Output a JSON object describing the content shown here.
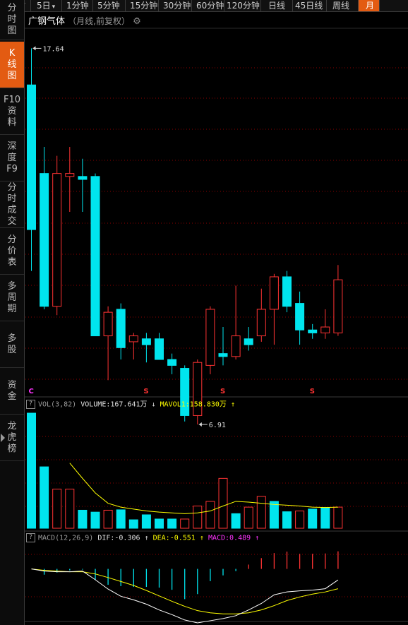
{
  "tabs": [
    "分时",
    "5日",
    "1分钟",
    "5分钟",
    "15分钟",
    "30分钟",
    "60分钟",
    "120分钟",
    "日线",
    "45日线",
    "周线",
    "月"
  ],
  "tabs_dropdown": "▾",
  "active_tab": 11,
  "sidebar": [
    "分\n时\n图",
    "K\n线\n图",
    "F10\n资\n料",
    "深\n度\nF9",
    "分\n时\n成\n交",
    "分\n价\n表",
    "多\n周\n期",
    "多\n股",
    "资\n金",
    "龙\n虎\n榜"
  ],
  "active_side": 1,
  "title": {
    "name": "广钢气体",
    "sub": "（月线,前复权）",
    "gear": "⚙"
  },
  "annotations": {
    "high_label": "17.64",
    "low_label": "6.91",
    "markers": [
      "C",
      "S",
      "S",
      "S"
    ]
  },
  "volume_header": {
    "q": "?",
    "vol_name": "VOL(3,82)",
    "volume": "VOLUME:167.641万",
    "volume_arrow": "↓",
    "mavol": "MAVOL1:158.830万",
    "mavol_arrow": "↑"
  },
  "macd_header": {
    "q": "?",
    "name": "MACD(12,26,9)",
    "dif": "DIF:-0.306",
    "dif_arrow": "↑",
    "dea": "DEA:-0.551",
    "dea_arrow": "↑",
    "macd": "MACD:0.489",
    "macd_arrow": "↑"
  },
  "colors": {
    "up": "#ff3333",
    "down": "#00e5ee",
    "ma": "#ffff00",
    "dif": "#ffffff",
    "dea": "#ffff00",
    "grid": "#8b0000",
    "accent": "#e35b12"
  },
  "chart_data": [
    {
      "type": "candlestick",
      "title": "广钢气体",
      "ylim": [
        6.0,
        18.2
      ],
      "high": 17.64,
      "low": 6.91,
      "candles": [
        {
          "o": 16.4,
          "c": 11.5,
          "h": 17.64,
          "l": 10.1
        },
        {
          "o": 13.4,
          "c": 8.9,
          "h": 14.3,
          "l": 8.8
        },
        {
          "o": 8.9,
          "c": 13.4,
          "h": 14.0,
          "l": 8.6
        },
        {
          "o": 13.3,
          "c": 13.4,
          "h": 14.3,
          "l": 12.1
        },
        {
          "o": 13.3,
          "c": 13.2,
          "h": 13.9,
          "l": 12.1
        },
        {
          "o": 13.3,
          "c": 7.9,
          "h": 13.4,
          "l": 7.9
        },
        {
          "o": 7.9,
          "c": 8.7,
          "h": 8.9,
          "l": 6.4
        },
        {
          "o": 8.8,
          "c": 7.5,
          "h": 9.0,
          "l": 7.1
        },
        {
          "o": 7.7,
          "c": 7.9,
          "h": 8.0,
          "l": 7.1
        },
        {
          "o": 7.8,
          "c": 7.6,
          "h": 8.0,
          "l": 7.0
        },
        {
          "o": 7.8,
          "c": 7.1,
          "h": 8.0,
          "l": 7.1
        },
        {
          "o": 7.1,
          "c": 6.9,
          "h": 7.3,
          "l": 6.6
        },
        {
          "o": 6.8,
          "c": 5.2,
          "h": 6.9,
          "l": 5.0
        },
        {
          "o": 5.2,
          "c": 7.0,
          "h": 7.1,
          "l": 4.9
        },
        {
          "o": 6.9,
          "c": 8.8,
          "h": 8.9,
          "l": 6.6
        },
        {
          "o": 7.3,
          "c": 7.2,
          "h": 8.2,
          "l": 6.9
        },
        {
          "o": 7.2,
          "c": 7.9,
          "h": 9.6,
          "l": 7.1
        },
        {
          "o": 7.8,
          "c": 7.6,
          "h": 8.2,
          "l": 7.4
        },
        {
          "o": 7.9,
          "c": 8.8,
          "h": 9.5,
          "l": 7.7
        },
        {
          "o": 8.8,
          "c": 9.9,
          "h": 10.0,
          "l": 7.6
        },
        {
          "o": 9.9,
          "c": 8.9,
          "h": 10.1,
          "l": 8.7
        },
        {
          "o": 9.0,
          "c": 8.1,
          "h": 9.4,
          "l": 7.6
        },
        {
          "o": 8.1,
          "c": 8.0,
          "h": 8.3,
          "l": 7.8
        },
        {
          "o": 8.0,
          "c": 8.2,
          "h": 8.8,
          "l": 7.8
        },
        {
          "o": 8.0,
          "c": 9.8,
          "h": 10.3,
          "l": 7.9
        }
      ]
    },
    {
      "type": "bar",
      "title": "VOL(3,82)",
      "ylim": [
        0,
        300
      ],
      "values": [
        300,
        160,
        102,
        102,
        47,
        42,
        47,
        48,
        22,
        35,
        24,
        24,
        24,
        58,
        70,
        130,
        38,
        55,
        83,
        70,
        43,
        45,
        50,
        54,
        55
      ],
      "up": [
        false,
        false,
        true,
        true,
        false,
        false,
        true,
        false,
        false,
        false,
        false,
        false,
        true,
        true,
        true,
        true,
        false,
        true,
        true,
        false,
        false,
        true,
        false,
        false,
        true
      ],
      "mavol": [
        null,
        null,
        null,
        170,
        130,
        92,
        65,
        55,
        50,
        45,
        42,
        40,
        38,
        40,
        45,
        58,
        70,
        68,
        65,
        62,
        60,
        58,
        55,
        54,
        55
      ]
    },
    {
      "type": "bar",
      "title": "MACD(12,26,9)",
      "ylim": [
        -1.5,
        0.6
      ],
      "hist": [
        0.0,
        -0.16,
        -0.1,
        -0.04,
        -0.02,
        -0.3,
        -0.44,
        -0.48,
        -0.5,
        -0.5,
        -0.52,
        -0.58,
        -0.84,
        -0.7,
        -0.34,
        -0.18,
        -0.06,
        0.12,
        0.3,
        0.44,
        0.48,
        0.42,
        0.42,
        0.43,
        0.489
      ],
      "dif": [
        0.0,
        -0.06,
        -0.08,
        -0.08,
        -0.06,
        -0.3,
        -0.56,
        -0.76,
        -0.86,
        -0.98,
        -1.14,
        -1.27,
        -1.42,
        -1.5,
        -1.44,
        -1.38,
        -1.3,
        -1.14,
        -0.96,
        -0.72,
        -0.64,
        -0.61,
        -0.59,
        -0.55,
        -0.306
      ],
      "dea": [
        0.0,
        -0.04,
        -0.06,
        -0.08,
        -0.08,
        -0.14,
        -0.24,
        -0.35,
        -0.46,
        -0.6,
        -0.75,
        -0.9,
        -1.04,
        -1.16,
        -1.22,
        -1.25,
        -1.25,
        -1.22,
        -1.14,
        -1.02,
        -0.88,
        -0.78,
        -0.7,
        -0.64,
        -0.551
      ]
    }
  ]
}
